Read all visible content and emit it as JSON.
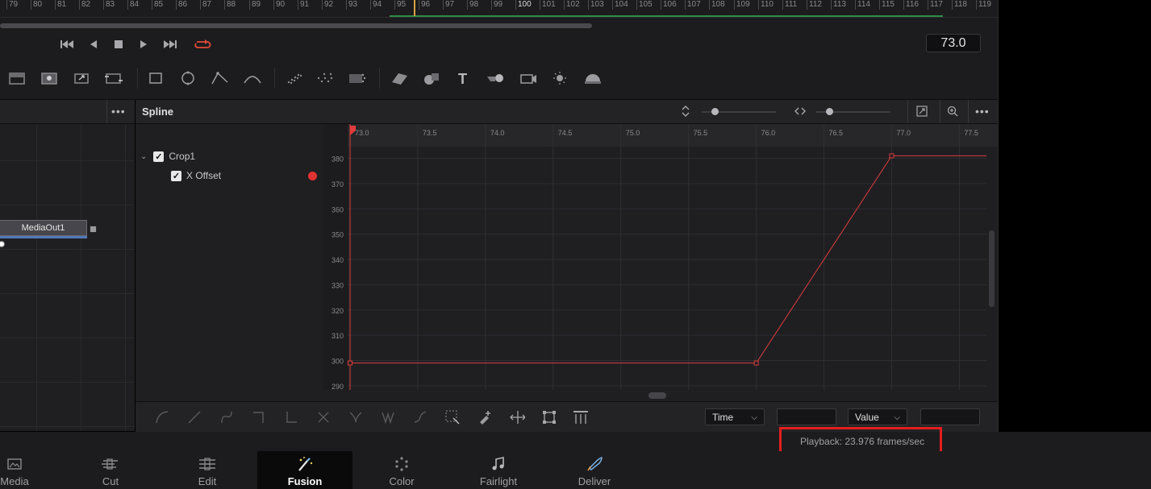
{
  "ruler": {
    "ticks": [
      "79",
      "80",
      "81",
      "82",
      "83",
      "84",
      "85",
      "86",
      "87",
      "88",
      "89",
      "90",
      "91",
      "92",
      "93",
      "94",
      "95",
      "96",
      "97",
      "98",
      "99",
      "100",
      "101",
      "102",
      "103",
      "104",
      "105",
      "106",
      "107",
      "108",
      "109",
      "110",
      "111",
      "112",
      "113",
      "114",
      "115",
      "116",
      "117",
      "118",
      "119"
    ]
  },
  "transport": {
    "timecode": "73.0",
    "buttons": [
      "skip-to-start-icon",
      "step-back-icon",
      "stop-icon",
      "play-icon",
      "skip-to-end-icon",
      "loop-icon"
    ]
  },
  "toolbar": {
    "tools": [
      "background-icon",
      "paint-icon",
      "transform-icon",
      "merge-icon",
      "rectangle-mask-icon",
      "ellipse-mask-icon",
      "polygon-mask-icon",
      "bspline-mask-icon",
      "particle-emitter-icon",
      "particle-render-icon",
      "particle-image-icon",
      "image-plane-3d-icon",
      "shape-3d-icon",
      "text-3d-icon",
      "merge-3d-icon",
      "camera-3d-icon",
      "light-icon",
      "renderer-3d-icon"
    ]
  },
  "node_editor": {
    "node_label": "MediaOut1"
  },
  "spline": {
    "title": "Spline",
    "tree": {
      "parent": "Crop1",
      "child": "X Offset"
    },
    "x_ticks": [
      "73.0",
      "73.5",
      "74.0",
      "74.5",
      "75.0",
      "75.5",
      "76.0",
      "76.5",
      "77.0",
      "77.5"
    ],
    "y_ticks": [
      "380",
      "370",
      "360",
      "350",
      "340",
      "330",
      "320",
      "310",
      "300",
      "290"
    ],
    "curve_color": "#e03c3c"
  },
  "chart_data": {
    "type": "line",
    "series": [
      {
        "values": [
          [
            73.0,
            299
          ],
          [
            76.0,
            299
          ],
          [
            77.0,
            381
          ],
          [
            77.7,
            381
          ]
        ]
      }
    ],
    "xlim": [
      73.0,
      77.7
    ],
    "ylim": [
      289,
      384
    ],
    "grid": true
  },
  "keyframe_tools": {
    "time_label": "Time",
    "value_label": "Value",
    "time_value": "",
    "value_value": ""
  },
  "status": {
    "text": "Playback: 23.976 frames/sec"
  },
  "pages": [
    {
      "label": "Media",
      "icon": "media-icon"
    },
    {
      "label": "Cut",
      "icon": "cut-icon"
    },
    {
      "label": "Edit",
      "icon": "edit-icon"
    },
    {
      "label": "Fusion",
      "icon": "fusion-icon",
      "active": true
    },
    {
      "label": "Color",
      "icon": "color-icon"
    },
    {
      "label": "Fairlight",
      "icon": "fairlight-icon"
    },
    {
      "label": "Deliver",
      "icon": "deliver-icon"
    }
  ],
  "colors": {
    "accent_red": "#e41d1d",
    "range_green": "#2e8d48",
    "playhead": "#d7a23c"
  }
}
